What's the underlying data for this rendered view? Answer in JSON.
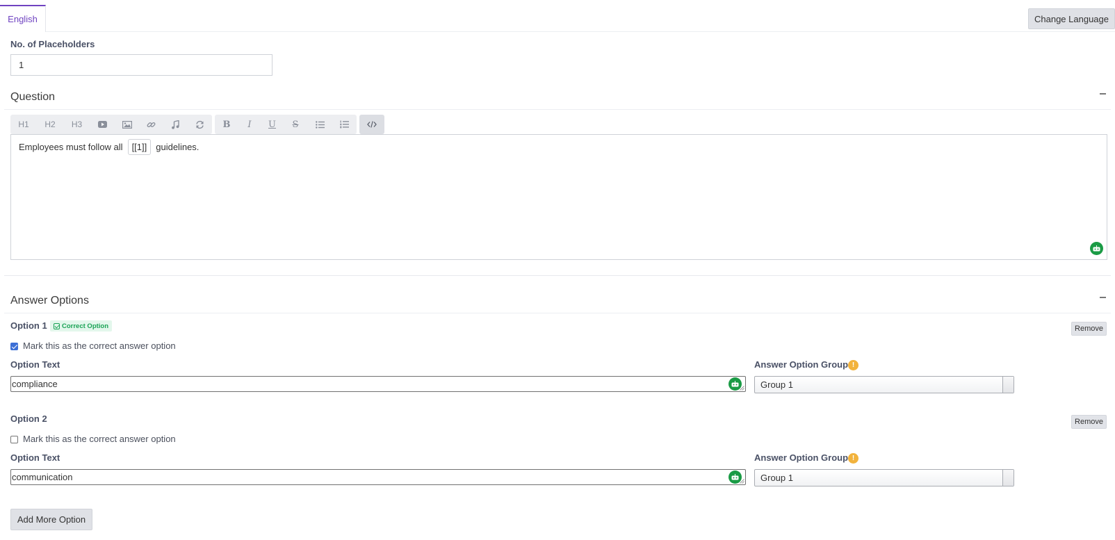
{
  "tabs": {
    "active_label": "English",
    "change_language_label": "Change Language"
  },
  "placeholders": {
    "label": "No. of Placeholders",
    "value": "1"
  },
  "question": {
    "title": "Question",
    "toolbar": {
      "h1": "H1",
      "h2": "H2",
      "h3": "H3",
      "icons": [
        "youtube-icon",
        "image-icon",
        "link-icon",
        "music-icon",
        "refresh-icon",
        "bold-icon",
        "italic-icon",
        "underline-icon",
        "strikethrough-icon",
        "bullet-list-icon",
        "numbered-list-icon",
        "code-view-icon"
      ]
    },
    "text_before": "Employees must follow all",
    "placeholder_chip": "[[1]]",
    "text_after": "guidelines."
  },
  "answers": {
    "title": "Answer Options",
    "options": [
      {
        "title": "Option 1",
        "badge": "Correct Option",
        "remove_label": "Remove",
        "checkbox_label": "Mark this as the correct answer option",
        "checked": true,
        "text_label": "Option Text",
        "text_value": "compliance",
        "group_label": "Answer Option Group",
        "group_value": "Group 1"
      },
      {
        "title": "Option 2",
        "remove_label": "Remove",
        "checkbox_label": "Mark this as the correct answer option",
        "checked": false,
        "text_label": "Option Text",
        "text_value": "communication",
        "group_label": "Answer Option Group",
        "group_value": "Group 1"
      }
    ],
    "add_more_label": "Add More Option"
  },
  "colors": {
    "accent": "#6f42c1",
    "success": "#1aa355",
    "bot": "#1a9b45",
    "info": "#f2b33d"
  }
}
